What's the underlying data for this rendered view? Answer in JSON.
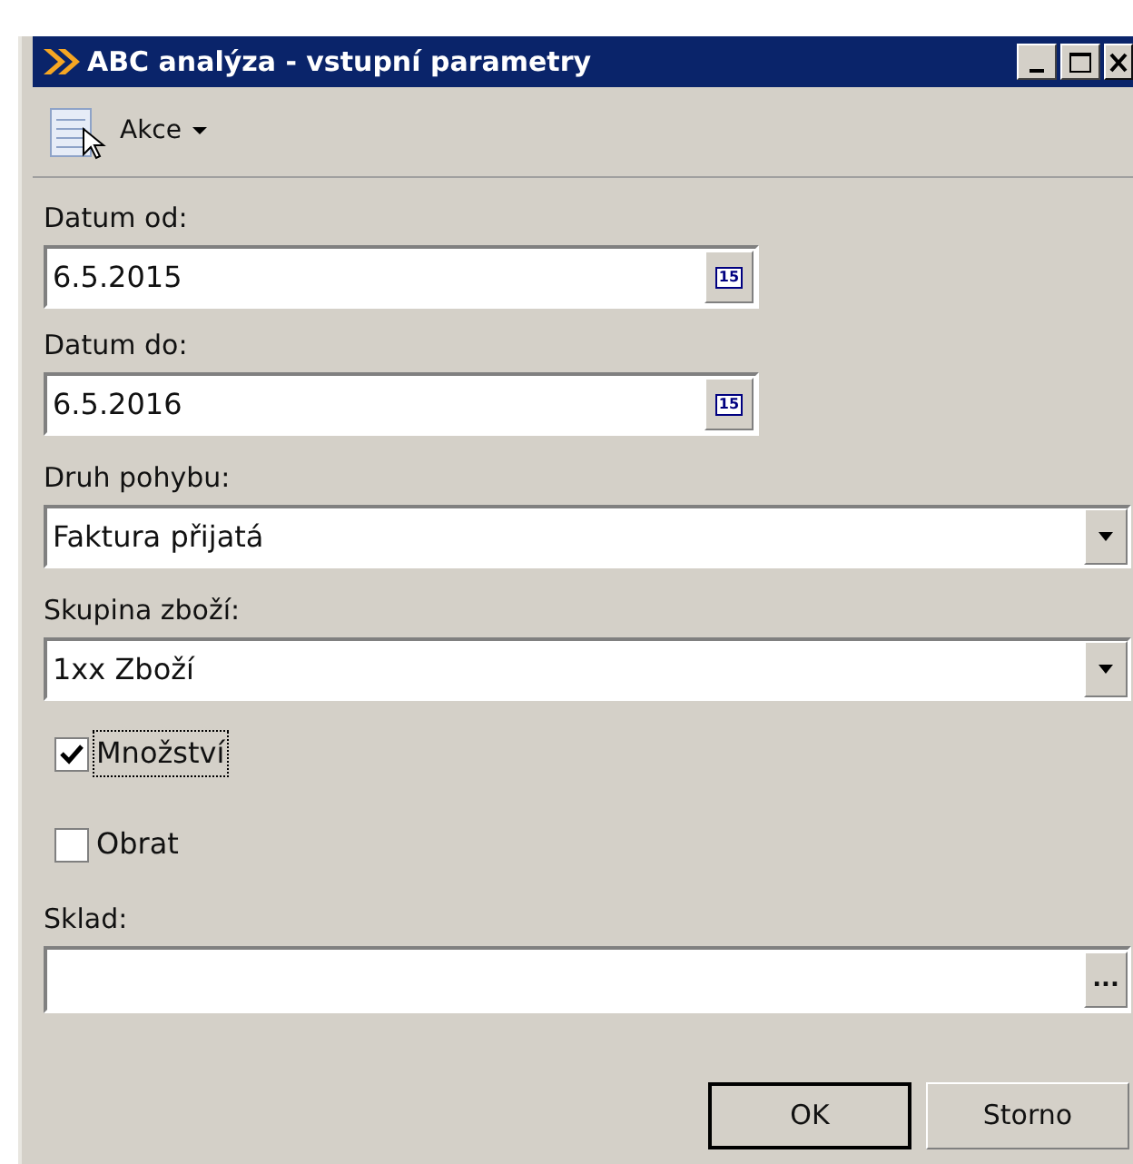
{
  "window": {
    "title": "ABC analýza - vstupní parametry"
  },
  "toolbar": {
    "label": "Akce"
  },
  "fields": [
    {
      "kind": "date",
      "label": "Datum od:",
      "value": "6.5.2015",
      "button": "15"
    },
    {
      "kind": "date",
      "label": "Datum do:",
      "value": "6.5.2016",
      "button": "15"
    },
    {
      "kind": "dropdown",
      "label": "Druh pohybu:",
      "value": "Faktura přijatá"
    },
    {
      "kind": "dropdown",
      "label": "Skupina zboží:",
      "value": "1xx Zboží"
    },
    {
      "kind": "checkbox",
      "label": "Množství",
      "checked": true,
      "focused": true
    },
    {
      "kind": "checkbox",
      "label": "Obrat",
      "checked": false,
      "focused": false
    },
    {
      "kind": "browse",
      "label": "Sklad:",
      "button": "..."
    }
  ],
  "buttons": [
    {
      "label": "OK",
      "default": true
    },
    {
      "label": "Storno",
      "default": false
    }
  ]
}
